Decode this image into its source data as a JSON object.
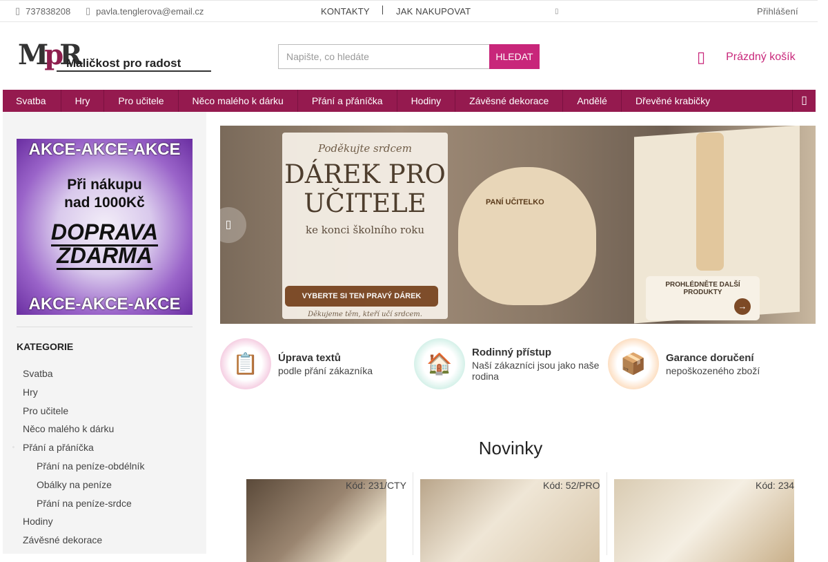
{
  "topbar": {
    "phone": "737838208",
    "email": "pavla.tenglerova@email.cz",
    "nav": [
      "KONTAKTY",
      "JAK NAKUPOVAT"
    ],
    "login": "Přihlášení"
  },
  "header": {
    "logo_mark": "MpR",
    "logo_text": "Maličkost pro radost",
    "search_placeholder": "Napište, co hledáte",
    "search_button": "HLEDAT",
    "cart_label": "Prázdný košík"
  },
  "menu": {
    "items": [
      "Svatba",
      "Hry",
      "Pro učitele",
      "Něco malého k dárku",
      "Přání a přáníčka",
      "Hodiny",
      "Závěsné dekorace",
      "Andělé",
      "Dřevěné krabičky"
    ]
  },
  "promo": {
    "line1": "AKCE-AKCE-AKCE",
    "line2a": "Při nákupu",
    "line2b": "nad 1000Kč",
    "line3a": "DOPRAVA",
    "line3b": "ZDARMA",
    "line4": "AKCE-AKCE-AKCE"
  },
  "categories": {
    "title": "KATEGORIE",
    "items": [
      {
        "label": "Svatba"
      },
      {
        "label": "Hry"
      },
      {
        "label": "Pro učitele"
      },
      {
        "label": "Něco malého k dárku"
      },
      {
        "label": "Přání a přáníčka"
      },
      {
        "label": "Přání na peníze-obdélník"
      },
      {
        "label": "Obálky na peníze"
      },
      {
        "label": "Přání na peníze-srdce"
      },
      {
        "label": "Hodiny"
      },
      {
        "label": "Závěsné dekorace"
      }
    ]
  },
  "banner": {
    "subtitle": "Poděkujte srdcem",
    "title_line1": "DÁREK PRO",
    "title_line2": "UČITELE",
    "tagline": "ke konci školního roku",
    "cta": "VYBERTE SI TEN PRAVÝ DÁREK",
    "footer": "Děkujeme těm, kteří učí srdcem.",
    "clover_title": "PANÍ UČITELKO",
    "card_title": "PROHLÉDNĚTE DALŠÍ PRODUKTY"
  },
  "features": [
    {
      "title": "Úprava textů",
      "text": "podle přání zákazníka"
    },
    {
      "title": "Rodinný přístup",
      "text": "Naší zákazníci jsou jako naše rodina"
    },
    {
      "title": "Garance doručení",
      "text": "nepoškozeného zboží"
    }
  ],
  "section_title": "Novinky",
  "products": [
    {
      "code": "Kód: 231/CTY"
    },
    {
      "code": "Kód: 52/PRO"
    },
    {
      "code": "Kód: 234"
    }
  ]
}
